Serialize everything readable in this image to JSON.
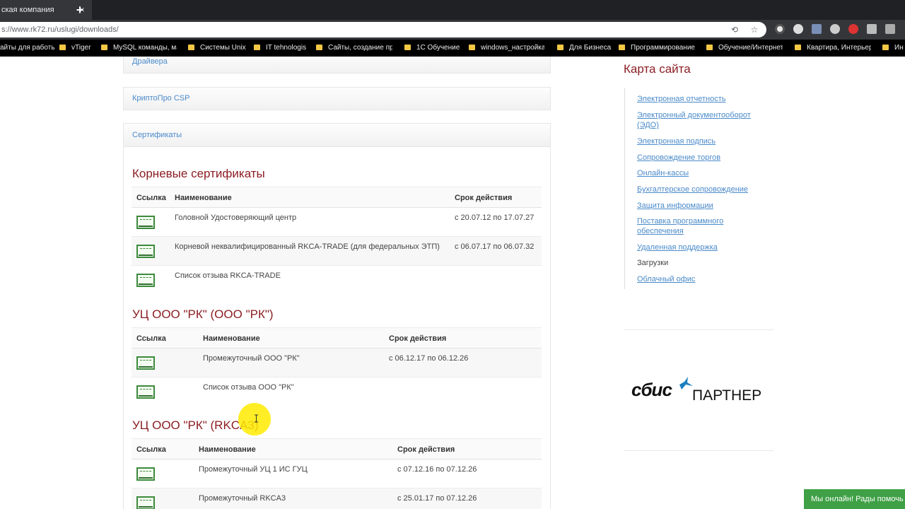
{
  "browser": {
    "tab_title": "ская компания",
    "tab_close": "×",
    "new_tab": "+",
    "url": "s://www.rk72.ru/uslugi/downloads/",
    "bookmarks": [
      "айты для работы",
      "vTiger",
      "MySQL команды, ма",
      "Системы Unix",
      "IT tehnologis",
      "Сайты, создание пр",
      "1С Обучение",
      "windows_настройка,",
      "Для Бизнеса",
      "Программирование",
      "Обучение/Интернет",
      "Квартира, Интерьер",
      "Ин"
    ]
  },
  "panels": [
    {
      "title": "Драйвера"
    },
    {
      "title": "КриптоПро CSP"
    },
    {
      "title": "Сертификаты"
    }
  ],
  "sections": [
    {
      "heading": "Корневые сертификаты",
      "headers": [
        "Ссылка",
        "Наименование",
        "Срок действия"
      ],
      "rows": [
        {
          "name": "Головной Удостоверяющий центр",
          "validity": "с 20.07.12 по 17.07.27"
        },
        {
          "name": "Корневой неквалифицированный RKCA-TRADE (для федеральных ЭТП)",
          "validity": "с 06.07.17 по 06.07.32"
        },
        {
          "name": "Список отзыва RKCA-TRADE",
          "validity": ""
        }
      ]
    },
    {
      "heading": "УЦ ООО \"РК\" (ООО \"РК\")",
      "headers": [
        "Ссылка",
        "Наименование",
        "Срок действия"
      ],
      "rows": [
        {
          "name": "Промежуточный ООО \"РК\"",
          "validity": "с 06.12.17 по 06.12.26"
        },
        {
          "name": "Список отзыва ООО \"РК\"",
          "validity": ""
        }
      ]
    },
    {
      "heading": "УЦ ООО \"РК\" (RKCA3)",
      "headers": [
        "Ссылка",
        "Наименование",
        "Срок действия"
      ],
      "rows": [
        {
          "name": "Промежуточный УЦ 1 ИС ГУЦ",
          "validity": "с 07.12.16 по 07.12.26"
        },
        {
          "name": "Промежуточный RKCA3",
          "validity": "с 25.01.17 по 07.12.26"
        }
      ]
    }
  ],
  "sidebar": {
    "title": "Карта сайта",
    "items": [
      {
        "label": "Электронная отчетность",
        "current": false
      },
      {
        "label": "Электронный документооборот (ЭДО)",
        "current": false
      },
      {
        "label": "Электронная подпись",
        "current": false
      },
      {
        "label": "Сопровождение торгов",
        "current": false
      },
      {
        "label": "Онлайн-кассы",
        "current": false
      },
      {
        "label": "Бухгалтерское сопровождение",
        "current": false
      },
      {
        "label": "Защита информации",
        "current": false
      },
      {
        "label": "Поставка программного обеспечения",
        "current": false
      },
      {
        "label": "Удаленная поддержка",
        "current": false
      },
      {
        "label": "Загрузки",
        "current": true
      },
      {
        "label": "Облачный офис",
        "current": false
      }
    ]
  },
  "partner_logo": {
    "word": "сбис",
    "tag": "ПАРТНЕР"
  },
  "chat": {
    "label": "Мы онлайн! Рады помочь"
  },
  "colors": {
    "heading": "#8b1e23",
    "link": "#4a8ac9",
    "chat": "#3fa045",
    "cert_icon": "#3c8a3c"
  },
  "icons": [
    "star-icon",
    "translate-icon",
    "certificate-icon",
    "sbis-bird-icon"
  ]
}
